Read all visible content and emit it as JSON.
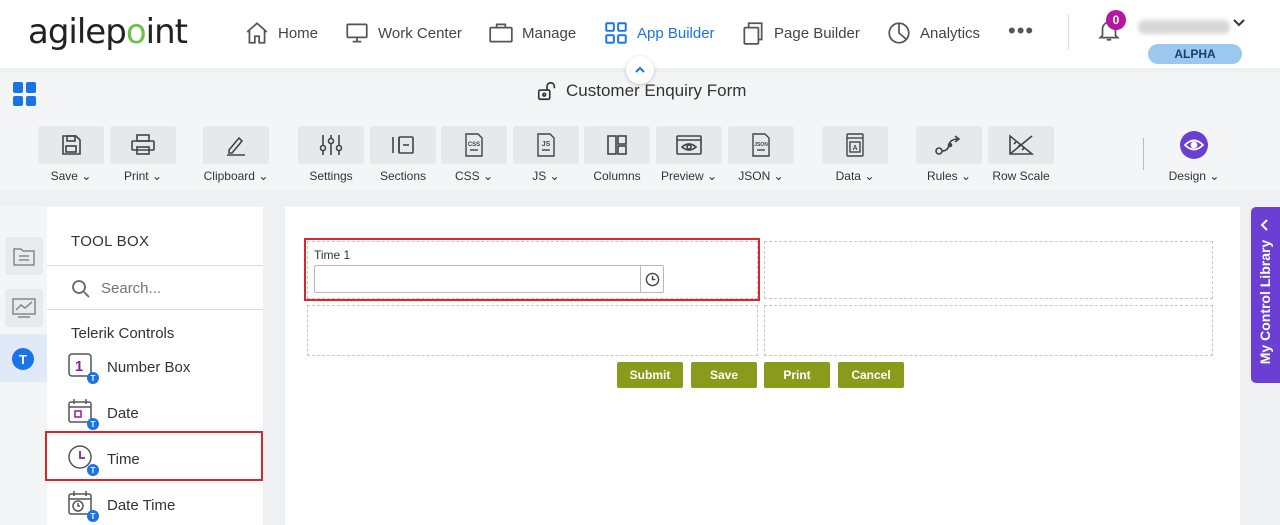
{
  "nav": {
    "logo_pre": "agilep",
    "logo_o": "o",
    "logo_post": "int",
    "items": [
      {
        "label": "Home",
        "icon": "home-icon"
      },
      {
        "label": "Work Center",
        "icon": "monitor-icon"
      },
      {
        "label": "Manage",
        "icon": "briefcase-icon"
      },
      {
        "label": "App Builder",
        "icon": "app-grid-icon"
      },
      {
        "label": "Page Builder",
        "icon": "pages-icon"
      },
      {
        "label": "Analytics",
        "icon": "pie-chart-icon"
      }
    ],
    "active": "App Builder",
    "more": "•••",
    "notifications": "0",
    "role_badge": "ALPHA",
    "accent": "#1a73e8"
  },
  "titlebar": {
    "form_title": "Customer Enquiry Form"
  },
  "toolbar": {
    "save": "Save",
    "print": "Print",
    "clipboard": "Clipboard",
    "settings": "Settings",
    "sections": "Sections",
    "css": "CSS",
    "js": "JS",
    "columns": "Columns",
    "preview": "Preview",
    "json": "JSON",
    "data": "Data",
    "rules": "Rules",
    "row_scale": "Row Scale",
    "design": "Design"
  },
  "toolbox": {
    "title": "TOOL BOX",
    "search_placeholder": "Search...",
    "group": "Telerik Controls",
    "items": [
      "Number Box",
      "Date",
      "Time",
      "Date Time"
    ]
  },
  "form": {
    "field_label": "Time 1",
    "field_value": "",
    "buttons": [
      "Submit",
      "Save",
      "Print",
      "Cancel"
    ],
    "button_color": "#8a9a1b"
  },
  "control_library": {
    "label": "My Control Library",
    "color": "#6b3fd4"
  }
}
